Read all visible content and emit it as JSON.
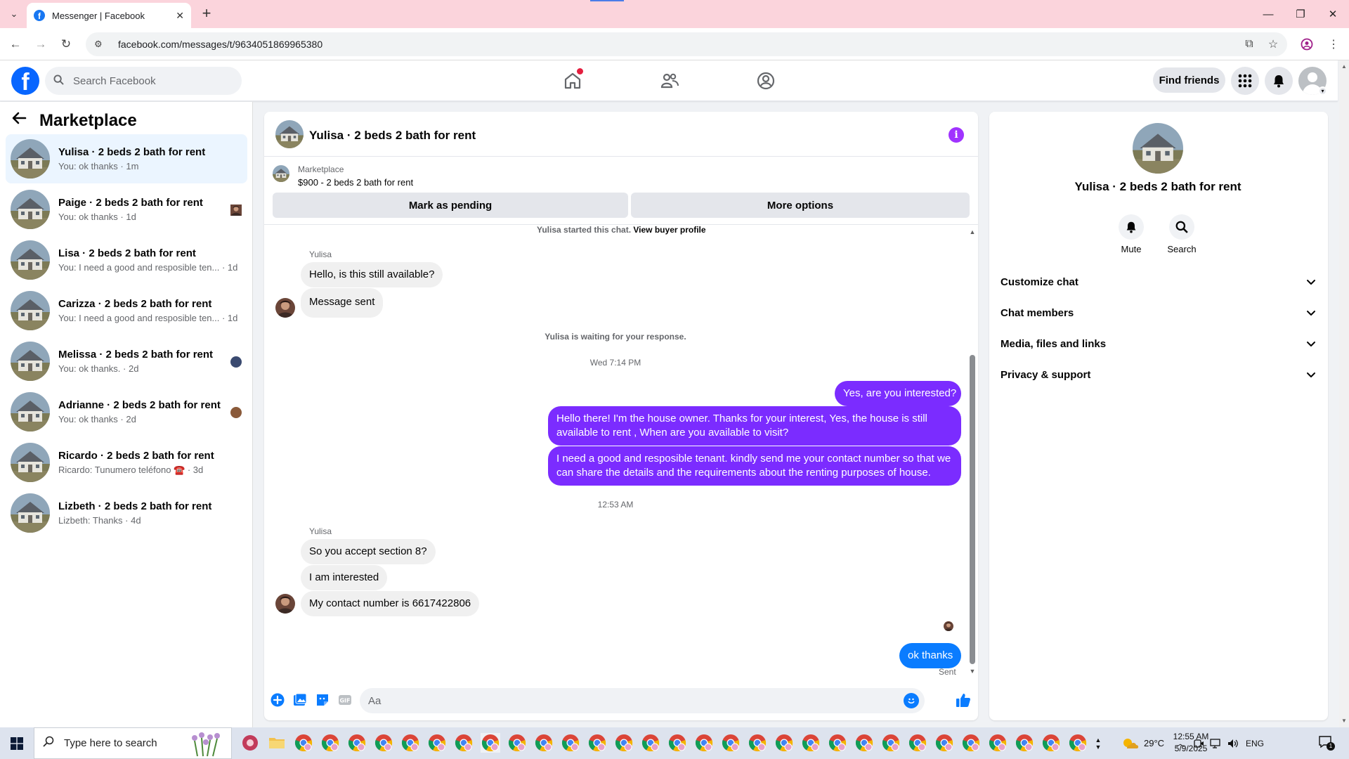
{
  "browser": {
    "tab_title": "Messenger | Facebook",
    "url": "facebook.com/messages/t/9634051869965380"
  },
  "header": {
    "search_placeholder": "Search Facebook",
    "find_friends": "Find friends"
  },
  "sidebar": {
    "title": "Marketplace",
    "conversations": [
      {
        "name": "Yulisa · 2 beds 2 bath for rent",
        "preview": "You: ok thanks · 1m",
        "active": true
      },
      {
        "name": "Paige · 2 beds 2 bath for rent",
        "preview": "You: ok thanks · 1d"
      },
      {
        "name": "Lisa · 2 beds 2 bath for rent",
        "preview": "You: I need a good and resposible ten... · 1d"
      },
      {
        "name": "Carizza · 2 beds 2 bath for rent",
        "preview": "You: I need a good and resposible ten... · 1d"
      },
      {
        "name": "Melissa · 2 beds 2 bath for rent",
        "preview": "You: ok thanks. · 2d"
      },
      {
        "name": "Adrianne · 2 beds 2 bath for rent",
        "preview": "You: ok thanks · 2d"
      },
      {
        "name": "Ricardo · 2 beds 2 bath for rent",
        "preview": "Ricardo: Tunumero teléfono ☎️ · 3d"
      },
      {
        "name": "Lizbeth · 2 beds 2 bath for rent",
        "preview": "Lizbeth: Thanks · 4d"
      }
    ]
  },
  "chat": {
    "title": "Yulisa · 2 beds 2 bath for rent",
    "marketplace_label": "Marketplace",
    "listing": "$900 - 2 beds 2 bath for rent",
    "mark_pending": "Mark as pending",
    "more_options": "More options",
    "started_note": "Yulisa started this chat.",
    "view_profile": "View buyer profile",
    "sender": "Yulisa",
    "msg1": "Hello, is this still available?",
    "msg2": "Message sent",
    "waiting_note": "Yulisa is waiting for your response.",
    "time1": "Wed 7:14 PM",
    "out1": "Yes, are you interested?",
    "out2": "Hello there! I'm the house owner. Thanks for your interest, Yes, the house is still available to rent , When are you available to visit?",
    "out3": "I need a good and resposible tenant.  kindly send me your contact number so that we can share the details and the requirements about the renting purposes of house.",
    "time2": "12:53 AM",
    "msg3": "So you accept section 8?",
    "msg4": "I am interested",
    "msg5": "My contact number is 6617422806",
    "out4": "ok thanks",
    "sent": "Sent",
    "composer_placeholder": "Aa"
  },
  "info_panel": {
    "name": "Yulisa · 2 beds 2 bath for rent",
    "mute": "Mute",
    "search": "Search",
    "rows": [
      "Customize chat",
      "Chat members",
      "Media, files and links",
      "Privacy & support"
    ]
  },
  "taskbar": {
    "search_text": "Type here to search",
    "temperature": "29°C",
    "language": "ENG",
    "time": "12:55 AM",
    "date": "5/9/2025",
    "notif_count": "1"
  },
  "colors": {
    "fb_blue": "#0866ff",
    "outgoing_purple": "#7b2cff",
    "outgoing_blue": "#0a7cff",
    "info_purple": "#a033ff"
  }
}
